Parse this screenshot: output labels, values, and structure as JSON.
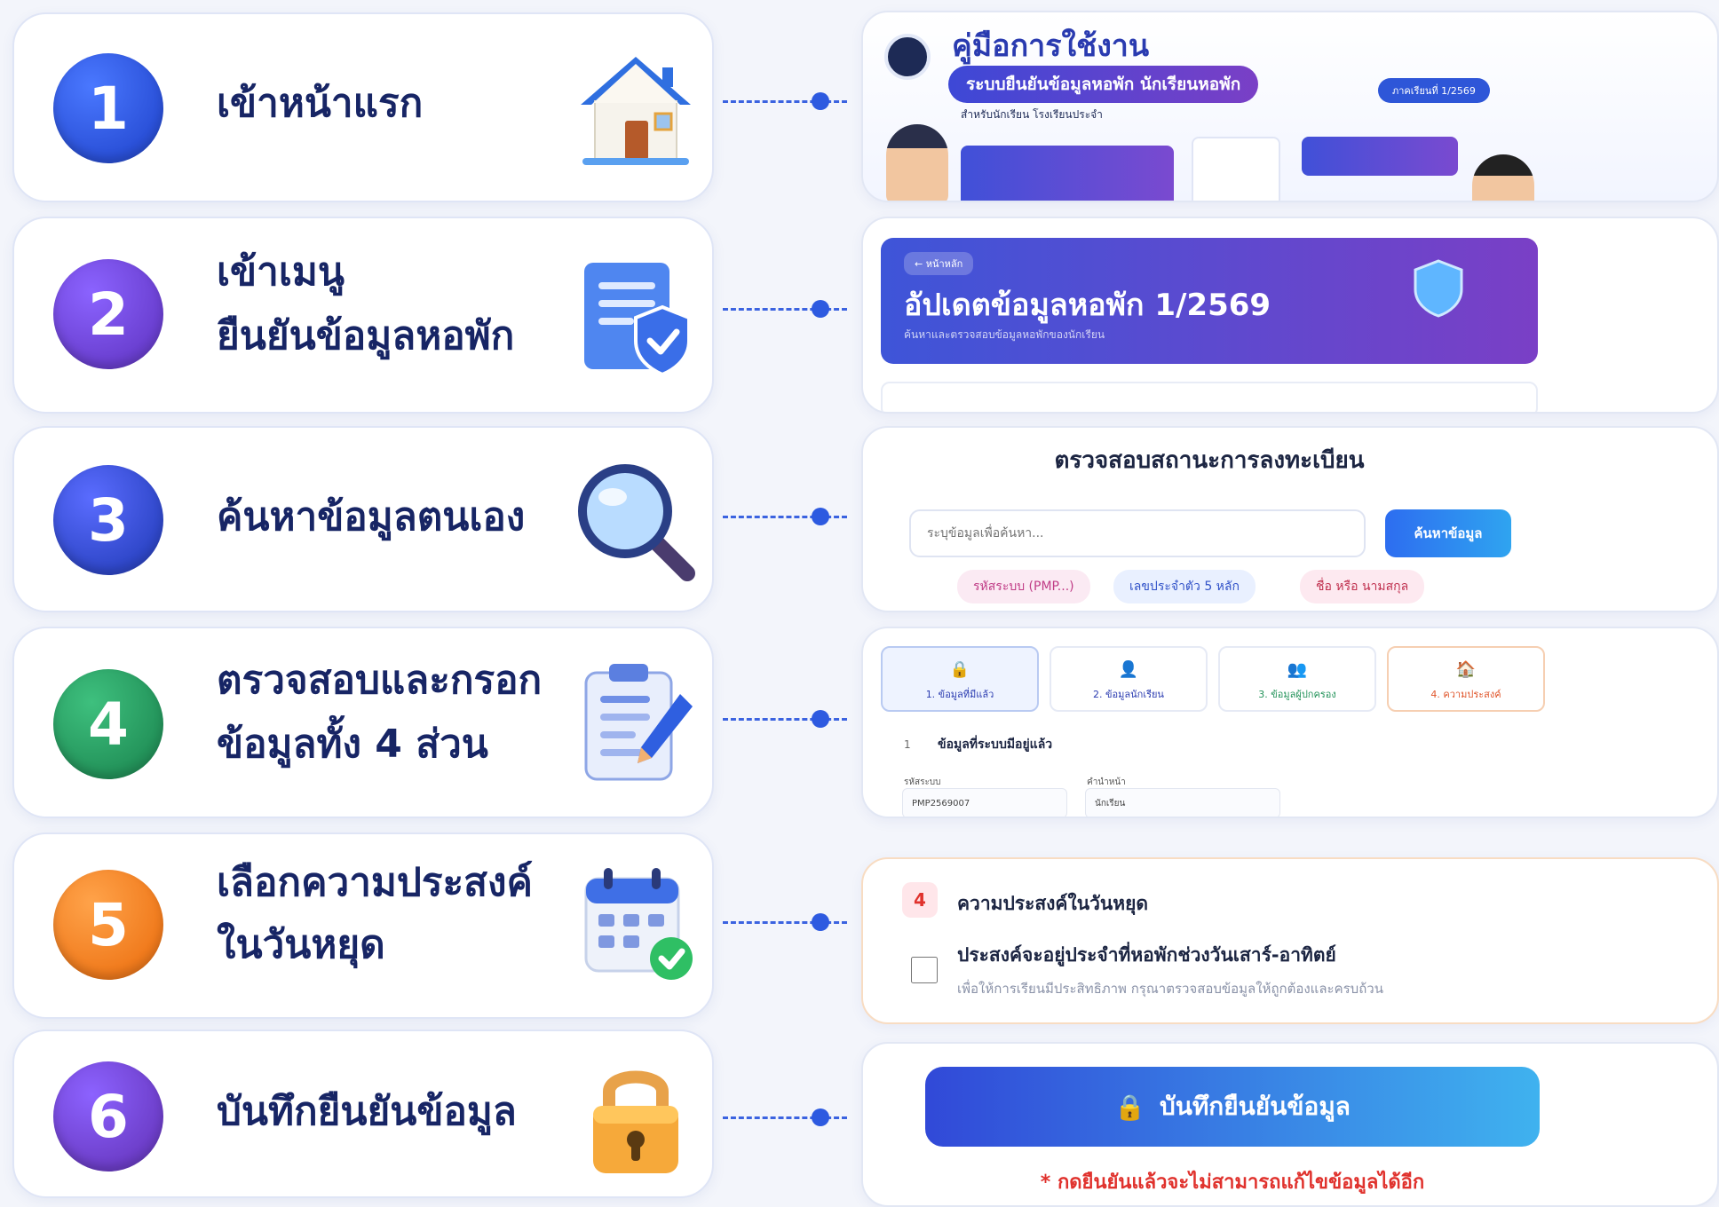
{
  "steps": [
    {
      "number": "1",
      "title": "เข้าหน้าแรก"
    },
    {
      "number": "2",
      "title": "เข้าเมนู",
      "title2": "ยืนยันข้อมูลหอพัก"
    },
    {
      "number": "3",
      "title": "ค้นหาข้อมูลตนเอง"
    },
    {
      "number": "4",
      "title": "ตรวจสอบและกรอก",
      "title2": "ข้อมูลทั้ง 4 ส่วน"
    },
    {
      "number": "5",
      "title": "เลือกความประสงค์",
      "title2": "ในวันหยุด"
    },
    {
      "number": "6",
      "title": "บันทึกยืนยันข้อมูล"
    }
  ],
  "icons": [
    "house-icon",
    "document-shield-icon",
    "magnifier-icon",
    "clipboard-pencil-icon",
    "calendar-check-icon",
    "padlock-icon"
  ],
  "colors": {
    "step1": "#2a50d8",
    "step2": "#6a3fd0",
    "step3": "#2f47c9",
    "step4": "#23935a",
    "step5": "#f07a1c",
    "step6": "#6d3ec9",
    "banner_from": "#3e55d8",
    "banner_to": "#7a3fc6",
    "warning_red": "#e0322d"
  },
  "screen1": {
    "title": "คู่มือการใช้งาน",
    "subtitle": "ระบบยืนยันข้อมูลหอพัก นักเรียนหอพัก",
    "caption": "สำหรับนักเรียน โรงเรียนประจำ",
    "badge": "ภาคเรียนที่ 1/2569"
  },
  "screen2": {
    "back_label": "← หน้าหลัก",
    "title": "อัปเดตข้อมูลหอพัก 1/2569",
    "description": "ค้นหาและตรวจสอบข้อมูลหอพักของนักเรียน"
  },
  "screen3": {
    "title": "ตรวจสอบสถานะการลงทะเบียน",
    "search_placeholder": "ระบุข้อมูลเพื่อค้นหา...",
    "search_button": "ค้นหาข้อมูล",
    "chips": [
      "รหัสระบบ (PMP...)",
      "เลขประจำตัว 5 หลัก",
      "ชื่อ หรือ นามสกุล"
    ]
  },
  "screen4": {
    "tabs": [
      "1. ข้อมูลที่มีแล้ว",
      "2. ข้อมูลนักเรียน",
      "3. ข้อมูลผู้ปกครอง",
      "4. ความประสงค์"
    ],
    "section_number": "1",
    "section_title": "ข้อมูลที่ระบบมีอยู่แล้ว",
    "field1_label": "รหัสระบบ",
    "field1_value": "PMP2569007",
    "field2_label": "คำนำหน้า",
    "field2_value": "นักเรียน"
  },
  "screen5": {
    "section_number": "4",
    "section_title": "ความประสงค์ในวันหยุด",
    "option_label": "ประสงค์จะอยู่ประจำที่หอพักช่วงวันเสาร์-อาทิตย์",
    "option_desc": "เพื่อให้การเรียนมีประสิทธิภาพ กรุณาตรวจสอบข้อมูลให้ถูกต้องและครบถ้วน"
  },
  "screen6": {
    "save_button": "บันทึกยืนยันข้อมูล",
    "warning": "* กดยืนยันแล้วจะไม่สามารถแก้ไขข้อมูลได้อีก"
  }
}
